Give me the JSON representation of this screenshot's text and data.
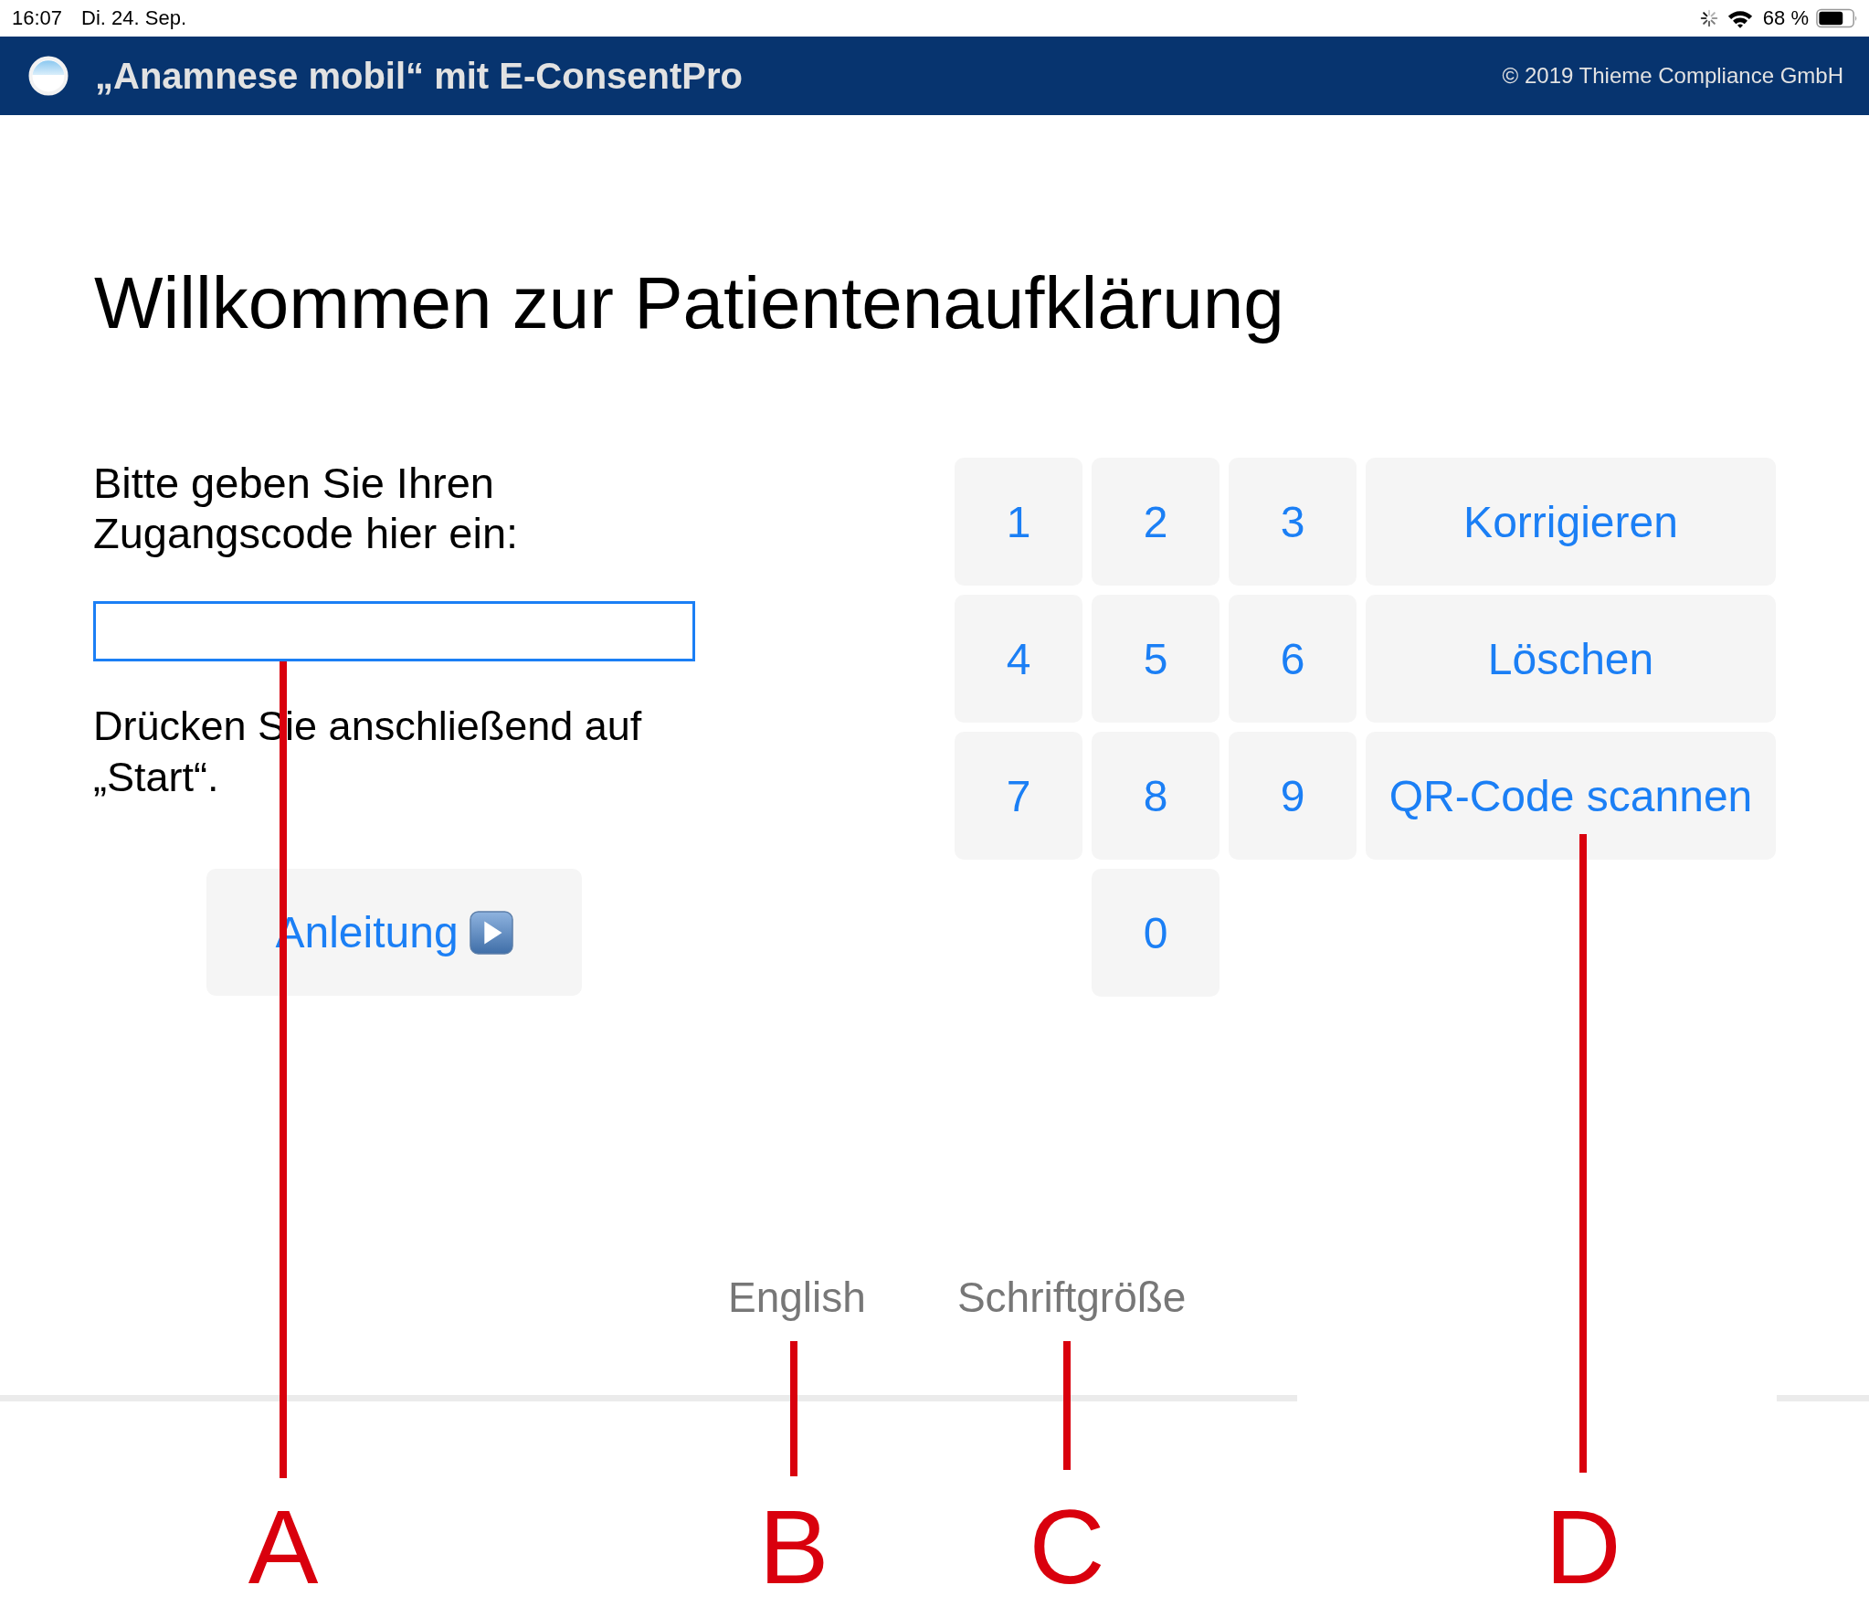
{
  "status_bar": {
    "time": "16:07",
    "date": "Di. 24. Sep.",
    "battery": "68 %"
  },
  "header": {
    "title": "„Anamnese mobil“ mit E-ConsentPro",
    "copyright": "© 2019 Thieme Compliance GmbH"
  },
  "heading": "Willkommen zur Patientenaufklärung",
  "code_entry": {
    "prompt": "Bitte geben Sie Ihren Zugangscode hier ein:",
    "code_field": {
      "focused": true
    },
    "hint": "Drücken Sie anschließend auf „Start“.",
    "guide_button": "Anleitung"
  },
  "keypad": {
    "digit_keys": [
      "1",
      "2",
      "3",
      "4",
      "5",
      "6",
      "7",
      "8",
      "9",
      "0"
    ],
    "action_buttons": [
      "Korrigieren",
      "Löschen",
      "QR-Code scannen"
    ]
  },
  "footer_links": [
    "English",
    "Schriftgröße"
  ],
  "annotations": [
    "A",
    "B",
    "C",
    "D"
  ]
}
